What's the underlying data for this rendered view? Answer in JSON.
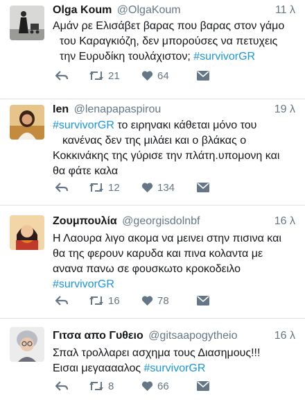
{
  "tweets": [
    {
      "name": "Olga Koum",
      "handle": "@OlgaKoum",
      "time": "11 λ",
      "line1": "Αμάν ρε Ελισάβετ βαρας που βαρας στον γάμο",
      "line2": "του Καραγκιόζη, δεν μπορούσες να πετυχεις",
      "line3_text": "την Ευρυδίκη τουλάχιστον; ",
      "line3_hashtag": "#survivorGR",
      "retweets": "21",
      "likes": "64",
      "avatar_icon": "person-with-stroller-avatar-icon"
    },
    {
      "name": "Ien",
      "handle": "@lenapapaspirou",
      "time": "19 λ",
      "line1_hashtag": "#survivorGR",
      "line1_text": " το ειρηνακι κάθεται μόνο του",
      "line2": "κανένας δεν της μιλάει και ο βλάκας ο",
      "line3": "Κοκκινάκης της γύρισε την πλάτη.υπομονη και",
      "line4": "θα φάτε  καλα",
      "retweets": "12",
      "likes": "134",
      "avatar_icon": "person-portrait-avatar-icon"
    },
    {
      "name": "Ζουμπουλία",
      "handle": "@georgisdolnbf",
      "time": "16 λ",
      "line1": "Η Λαουρα λιγο ακομα να μεινει στην πισινα και",
      "line2": "θα της φερουν καρυδα και πινα κολαντα με",
      "line3": "ανανα πανω σε φουσκωτο κροκοδειλο",
      "line4_hashtag": "#survivorGR",
      "retweets": "16",
      "likes": "78",
      "avatar_icon": "illustrated-woman-avatar-icon"
    },
    {
      "name": "Γιτσα απο Γυθειο",
      "handle": "@gitsaapogytheio",
      "time": "16 λ",
      "line1": "Σπαλ τρολλαρει ασχημα τους Διασημους!!!",
      "line2_text": "Εισαι μεγααααλος ",
      "line2_hashtag": "#survivorGR",
      "retweets": "8",
      "likes": "66",
      "avatar_icon": "elderly-woman-avatar-icon"
    }
  ],
  "colors": {
    "hashtag": "#1b95e0",
    "secondary_text": "#657786",
    "divider": "#dfe3e6"
  }
}
